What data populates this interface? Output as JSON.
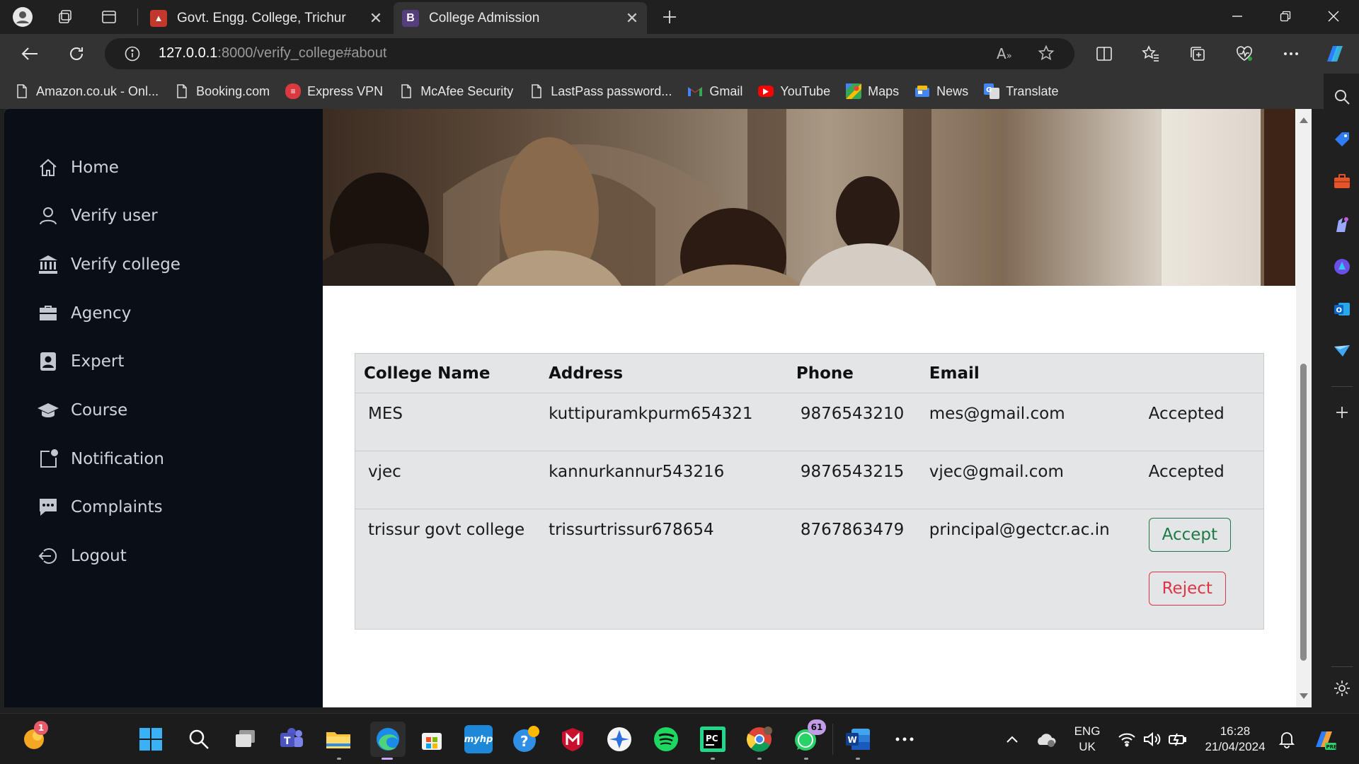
{
  "browser": {
    "tabs": [
      {
        "title": "Govt. Engg. College, Trichur",
        "favicon": "college-logo-icon",
        "active": false
      },
      {
        "title": "College Admission",
        "favicon": "bootstrap-icon",
        "favicon_letter": "B",
        "active": true
      }
    ],
    "url": {
      "host": "127.0.0.1",
      "path": ":8000/verify_college#about"
    },
    "bookmarks": [
      {
        "label": "Amazon.co.uk - Onl...",
        "icon": "page-icon"
      },
      {
        "label": "Booking.com",
        "icon": "page-icon"
      },
      {
        "label": "Express VPN",
        "icon": "expressvpn-icon"
      },
      {
        "label": "McAfee Security",
        "icon": "page-icon"
      },
      {
        "label": "LastPass password...",
        "icon": "page-icon"
      },
      {
        "label": "Gmail",
        "icon": "gmail-icon"
      },
      {
        "label": "YouTube",
        "icon": "youtube-icon"
      },
      {
        "label": "Maps",
        "icon": "maps-icon"
      },
      {
        "label": "News",
        "icon": "news-icon"
      },
      {
        "label": "Translate",
        "icon": "translate-icon"
      }
    ]
  },
  "sidebar": {
    "items": [
      {
        "label": "Home",
        "icon": "home-icon"
      },
      {
        "label": "Verify user",
        "icon": "user-icon"
      },
      {
        "label": "Verify college",
        "icon": "bank-icon"
      },
      {
        "label": "Agency",
        "icon": "briefcase-icon"
      },
      {
        "label": "Expert",
        "icon": "person-badge-icon"
      },
      {
        "label": "Course",
        "icon": "mortarboard-icon"
      },
      {
        "label": "Notification",
        "icon": "bell-square-icon"
      },
      {
        "label": "Complaints",
        "icon": "chat-icon"
      },
      {
        "label": "Logout",
        "icon": "logout-icon"
      }
    ]
  },
  "table": {
    "headers": [
      "College Name",
      "Address",
      "Phone",
      "Email"
    ],
    "rows": [
      {
        "name": "MES",
        "address": "kuttipuramkpurm654321",
        "phone": "9876543210",
        "email": "mes@gmail.com",
        "status": "Accepted"
      },
      {
        "name": "vjec",
        "address": "kannurkannur543216",
        "phone": "9876543215",
        "email": "vjec@gmail.com",
        "status": "Accepted"
      },
      {
        "name": "trissur govt college",
        "address": "trissurtrissur678654",
        "phone": "8767863479",
        "email": "principal@gectcr.ac.in",
        "accept_label": "Accept",
        "reject_label": "Reject"
      }
    ]
  },
  "colors": {
    "accepted": "#2e9f3e",
    "accept_btn": "#1d7a45",
    "reject_btn": "#dc3545",
    "back_to_top": "#1a8ddb",
    "sidebar_bg": "#0a0e16"
  },
  "taskbar": {
    "language": {
      "line1": "ENG",
      "line2": "UK"
    },
    "time": "16:28",
    "date": "21/04/2024",
    "badges": {
      "weather": "1",
      "whatsapp": "61"
    }
  }
}
